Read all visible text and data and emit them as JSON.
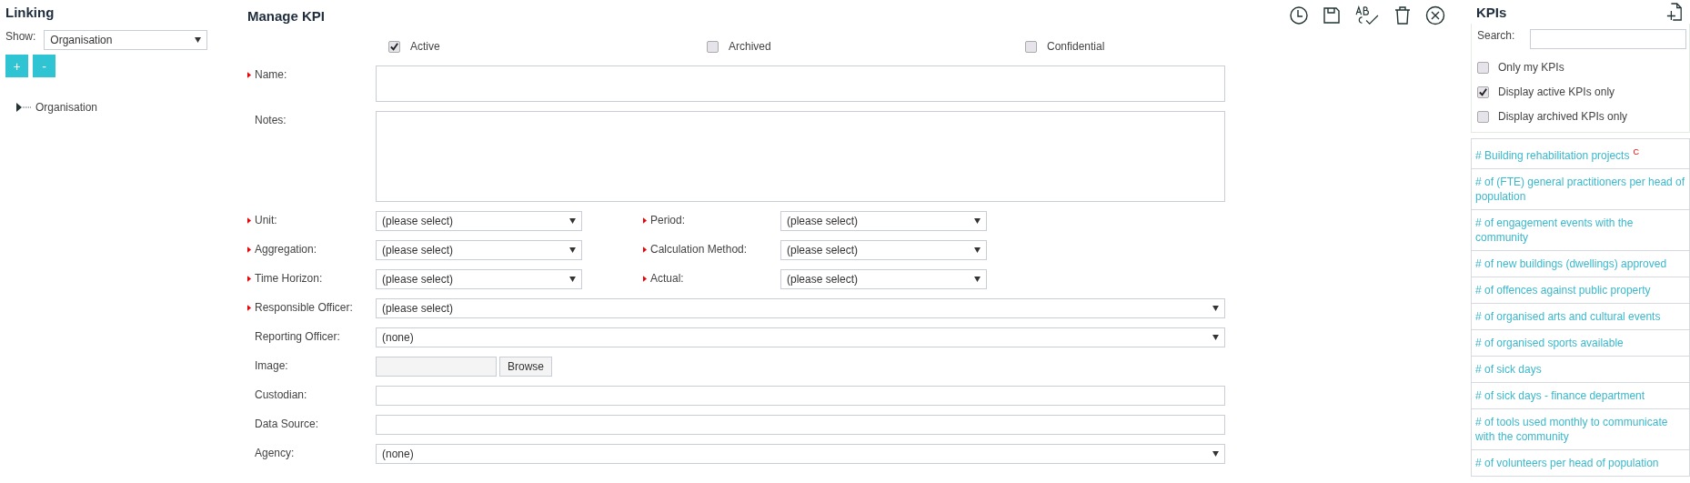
{
  "linking": {
    "title": "Linking",
    "show_label": "Show:",
    "show_value": "Organisation",
    "buttons": [
      "+",
      "-"
    ],
    "tree": [
      {
        "label": "Organisation",
        "expanded": false
      }
    ]
  },
  "form": {
    "title": "Manage KPI",
    "flags": [
      {
        "label": "Active",
        "checked": true
      },
      {
        "label": "Archived",
        "checked": false
      },
      {
        "label": "Confidential",
        "checked": false
      }
    ],
    "rows": [
      [
        {
          "kind": "text",
          "label": "Name:",
          "required": true
        }
      ],
      [
        {
          "kind": "textarea",
          "label": "Notes:",
          "required": false
        }
      ],
      [
        {
          "kind": "select",
          "label": "Unit:",
          "required": true,
          "value": "(please select)"
        },
        {
          "kind": "select",
          "label": "Period:",
          "required": true,
          "value": "(please select)"
        }
      ],
      [
        {
          "kind": "select",
          "label": "Aggregation:",
          "required": true,
          "value": "(please select)"
        },
        {
          "kind": "select",
          "label": "Calculation Method:",
          "required": true,
          "value": "(please select)"
        }
      ],
      [
        {
          "kind": "select",
          "label": "Time Horizon:",
          "required": true,
          "value": "(please select)"
        },
        {
          "kind": "select",
          "label": "Actual:",
          "required": true,
          "value": "(please select)"
        }
      ],
      [
        {
          "kind": "select",
          "label": "Responsible Officer:",
          "required": true,
          "value": "(please select)"
        }
      ],
      [
        {
          "kind": "select",
          "label": "Reporting Officer:",
          "required": false,
          "value": "(none)"
        }
      ],
      [
        {
          "kind": "file",
          "label": "Image:",
          "required": false,
          "button": "Browse"
        }
      ],
      [
        {
          "kind": "text",
          "label": "Custodian:",
          "required": false
        }
      ],
      [
        {
          "kind": "text",
          "label": "Data Source:",
          "required": false
        }
      ],
      [
        {
          "kind": "select",
          "label": "Agency:",
          "required": false,
          "value": "(none)"
        }
      ]
    ]
  },
  "kpis": {
    "title": "KPIs",
    "search_label": "Search:",
    "filters": [
      {
        "label": "Only my KPIs",
        "checked": false
      },
      {
        "label": "Display active KPIs only",
        "checked": true
      },
      {
        "label": "Display archived KPIs only",
        "checked": false
      }
    ],
    "items": [
      {
        "label": "# Building rehabilitation projects",
        "badge": "C"
      },
      {
        "label": "# of (FTE) general practitioners per head of population"
      },
      {
        "label": "# of engagement events with the community"
      },
      {
        "label": "# of new buildings (dwellings) approved"
      },
      {
        "label": "# of offences against public property"
      },
      {
        "label": "# of organised arts and cultural events"
      },
      {
        "label": "# of organised sports available"
      },
      {
        "label": "# of sick days"
      },
      {
        "label": "# of sick days - finance department"
      },
      {
        "label": "# of tools used monthly to communicate with the community"
      },
      {
        "label": "# of volunteers per head of population"
      }
    ]
  }
}
